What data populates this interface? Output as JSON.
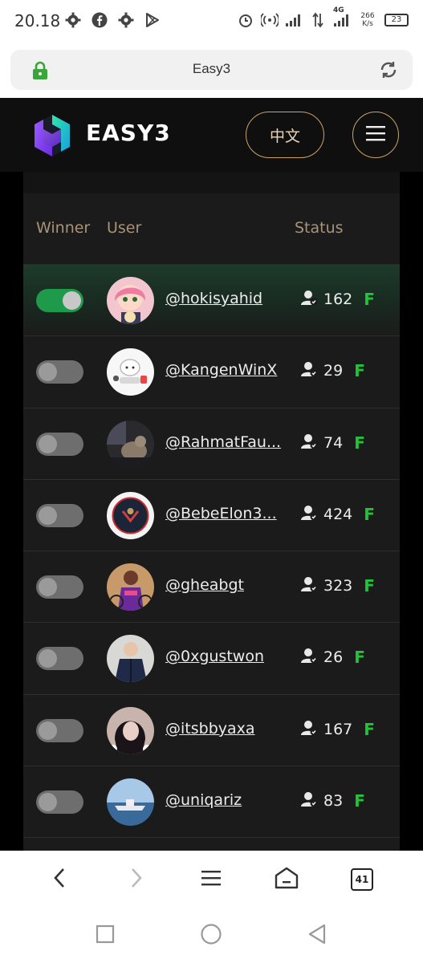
{
  "status_bar": {
    "time": "20.18",
    "network": "4G",
    "speed_value": "266",
    "speed_unit": "K/s",
    "battery": "23",
    "left_icons": [
      "gear-icon",
      "facebook-icon",
      "gear-icon",
      "play-store-icon"
    ],
    "right_icons": [
      "alarm-icon",
      "hotspot-icon",
      "signal-icon",
      "data-arrows-icon",
      "signal-4g-icon"
    ]
  },
  "browser": {
    "address_title": "Easy3",
    "tabs_count": "41"
  },
  "header": {
    "logo_text": "EASY3",
    "lang_button": "中文"
  },
  "table": {
    "columns": {
      "winner": "Winner",
      "user": "User",
      "status": "Status"
    },
    "rows": [
      {
        "handle": "@hokisyahid",
        "followers": "162",
        "flag": "F",
        "winner": true
      },
      {
        "handle": "@KangenWinX",
        "followers": "29",
        "flag": "F",
        "winner": false
      },
      {
        "handle": "@RahmatFau...",
        "followers": "74",
        "flag": "F",
        "winner": false
      },
      {
        "handle": "@BebeElon3...",
        "followers": "424",
        "flag": "F",
        "winner": false
      },
      {
        "handle": "@gheabgt",
        "followers": "323",
        "flag": "F",
        "winner": false
      },
      {
        "handle": "@0xgustwon",
        "followers": "26",
        "flag": "F",
        "winner": false
      },
      {
        "handle": "@itsbbyaxa",
        "followers": "167",
        "flag": "F",
        "winner": false
      },
      {
        "handle": "@uniqariz",
        "followers": "83",
        "flag": "F",
        "winner": false
      }
    ]
  },
  "colors": {
    "accent_gold": "#c9a36a",
    "toggle_on": "#1e9a4a",
    "flag_green": "#22c33a",
    "header_bg": "#0f0f0f",
    "panel_bg": "#1b1b1b"
  }
}
